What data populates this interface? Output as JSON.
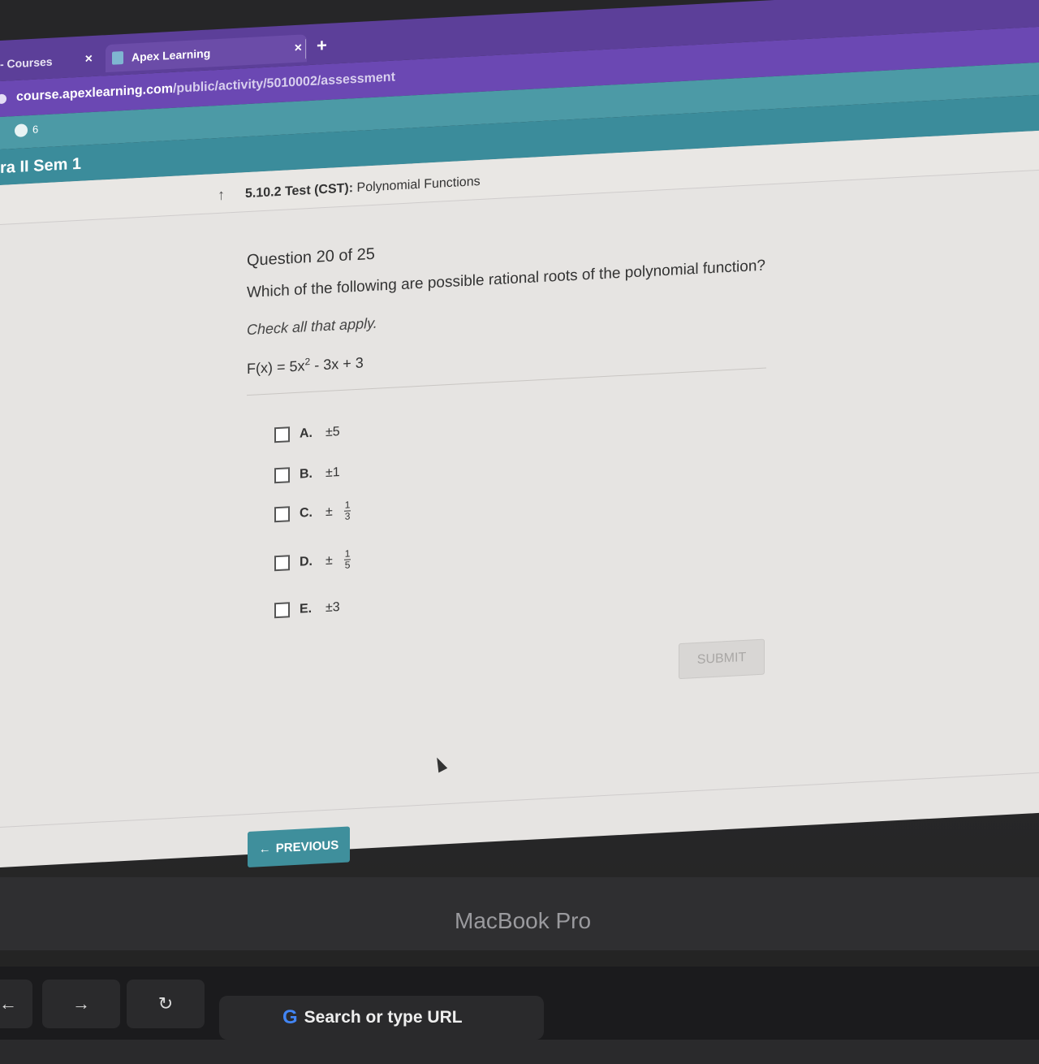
{
  "browser": {
    "tabs": [
      {
        "label": "- Courses"
      },
      {
        "label": "Apex Learning"
      }
    ],
    "tab_close": "×",
    "new_tab": "+",
    "url_host": "course.apexlearning.com",
    "url_path": "/public/activity/5010002/assessment",
    "bookmark_count": "6"
  },
  "course": {
    "title": "ra II Sem 1"
  },
  "breadcrumb": {
    "code": "5.10.2",
    "type": "Test (CST):",
    "name": "Polynomial Functions"
  },
  "question": {
    "number": "Question 20 of 25",
    "text": "Which of the following are possible rational roots of the polynomial function?",
    "instruction": "Check all that apply.",
    "formula_left": "F(x) = 5x",
    "formula_exp": "2",
    "formula_right": " - 3x + 3"
  },
  "choices": [
    {
      "letter": "A.",
      "value": "±5"
    },
    {
      "letter": "B.",
      "value": "±1"
    },
    {
      "letter": "C.",
      "sign": "±",
      "num": "1",
      "den": "3"
    },
    {
      "letter": "D.",
      "sign": "±",
      "num": "1",
      "den": "5"
    },
    {
      "letter": "E.",
      "value": "±3"
    }
  ],
  "buttons": {
    "submit": "SUBMIT",
    "previous": "PREVIOUS"
  },
  "device": {
    "brand": "MacBook Pro",
    "touchbar_url": "Search or type URL"
  }
}
